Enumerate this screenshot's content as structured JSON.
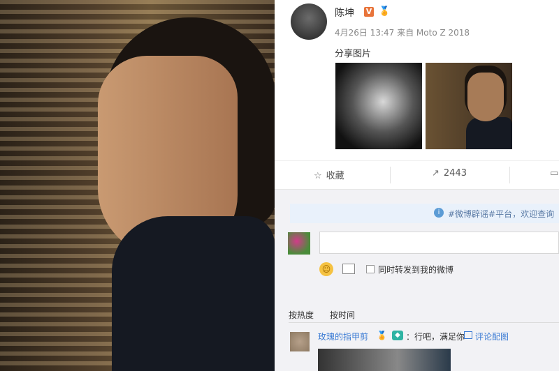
{
  "post": {
    "author": "陈坤",
    "verified_badge": "V",
    "medal_icon": "medal-icon",
    "meta": "4月26日 13:47 来自 Moto Z 2018",
    "text": "分享图片",
    "images": [
      "lion-photo",
      "portrait-photo"
    ]
  },
  "actions": {
    "favorite": "收藏",
    "repost_count": "2443"
  },
  "notice": {
    "text": "#微博辟谣#平台，欢迎查询"
  },
  "composer": {
    "input_value": "",
    "repost_checkbox_label": "同时转发到我的微博"
  },
  "comment_tabs": {
    "hot": "按热度",
    "time": "按时间"
  },
  "comment": {
    "user": "玫瑰的指甲剪",
    "text": "：行吧，满足你",
    "pic_label": "评论配图"
  },
  "colors": {
    "link": "#3b7bd4",
    "badge": "#e8743a",
    "notice_bg": "#e9f1fb"
  }
}
